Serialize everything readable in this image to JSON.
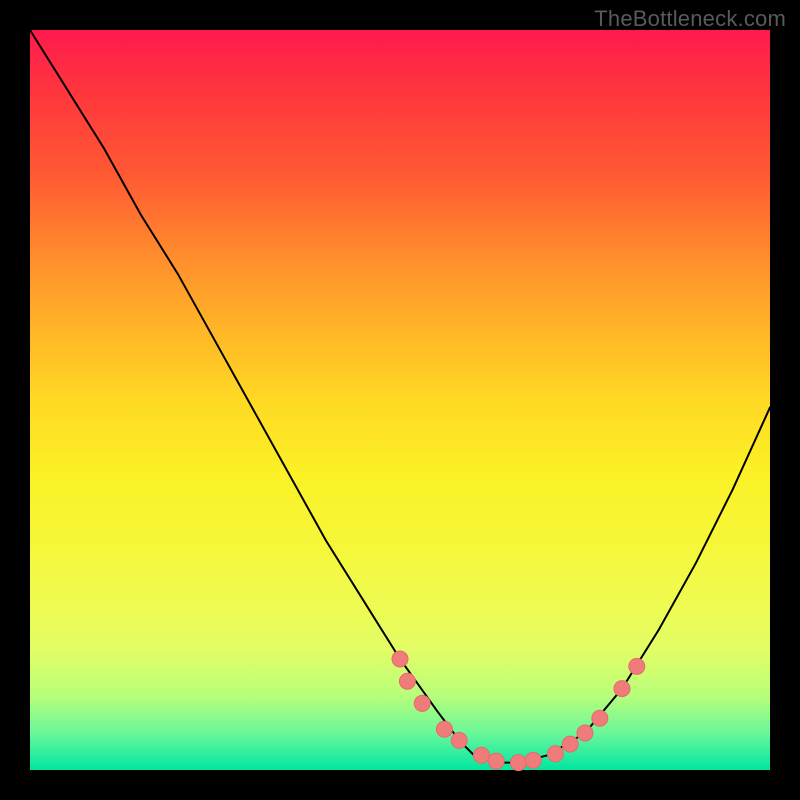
{
  "watermark": "TheBottleneck.com",
  "chart_data": {
    "type": "line",
    "title": "",
    "xlabel": "",
    "ylabel": "",
    "xlim": [
      0,
      100
    ],
    "ylim": [
      0,
      100
    ],
    "curve": {
      "x": [
        0,
        5,
        10,
        15,
        20,
        25,
        30,
        35,
        40,
        45,
        50,
        55,
        58,
        60,
        63,
        66,
        70,
        75,
        80,
        85,
        90,
        95,
        100
      ],
      "y": [
        100,
        92,
        84,
        75,
        67,
        58,
        49,
        40,
        31,
        23,
        15,
        8,
        4,
        2,
        1,
        1,
        2,
        5,
        11,
        19,
        28,
        38,
        49
      ]
    },
    "markers": {
      "x": [
        50,
        51,
        53,
        56,
        58,
        61,
        63,
        66,
        68,
        71,
        73,
        75,
        77,
        80,
        82
      ],
      "y": [
        15,
        12,
        9,
        5.5,
        4,
        2,
        1.2,
        1,
        1.3,
        2.2,
        3.5,
        5,
        7,
        11,
        14
      ]
    },
    "colors": {
      "curve": "#000000",
      "marker_fill": "#ef7b7b",
      "marker_stroke": "#e86a6a"
    }
  }
}
